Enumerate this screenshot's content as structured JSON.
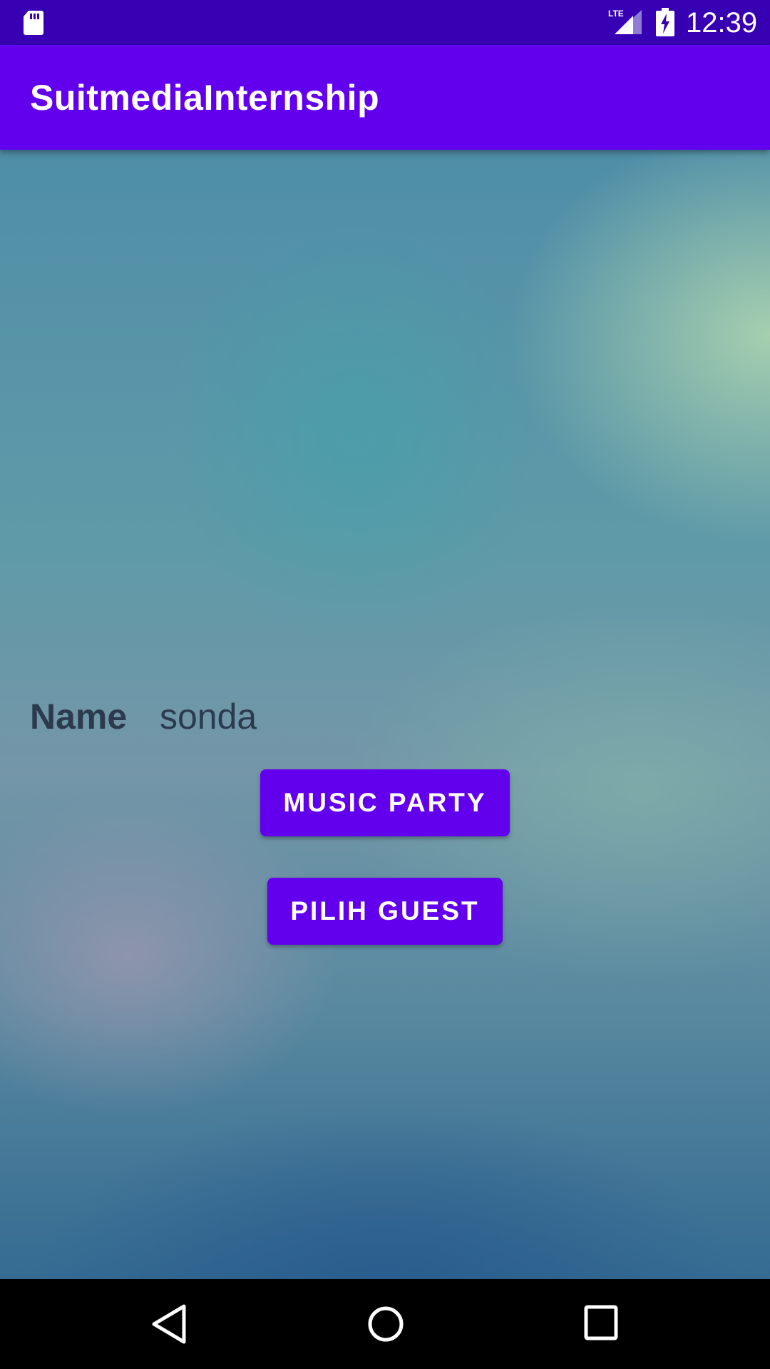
{
  "status_bar": {
    "time": "12:39",
    "network_label": "LTE",
    "icons": [
      "sd-card-icon",
      "lte-signal-icon",
      "battery-charging-icon"
    ]
  },
  "app_bar": {
    "title": "SuitmediaInternship"
  },
  "form": {
    "name_label": "Name",
    "name_value": "sonda"
  },
  "buttons": {
    "music_party": "MUSIC PARTY",
    "pilih_guest": "PILIH GUEST"
  },
  "nav_bar": {
    "icons": [
      "back-icon",
      "home-icon",
      "recent-apps-icon"
    ]
  },
  "colors": {
    "status_bar": "#3700b3",
    "primary": "#6200ee",
    "text_dark": "#2b3a4d"
  }
}
